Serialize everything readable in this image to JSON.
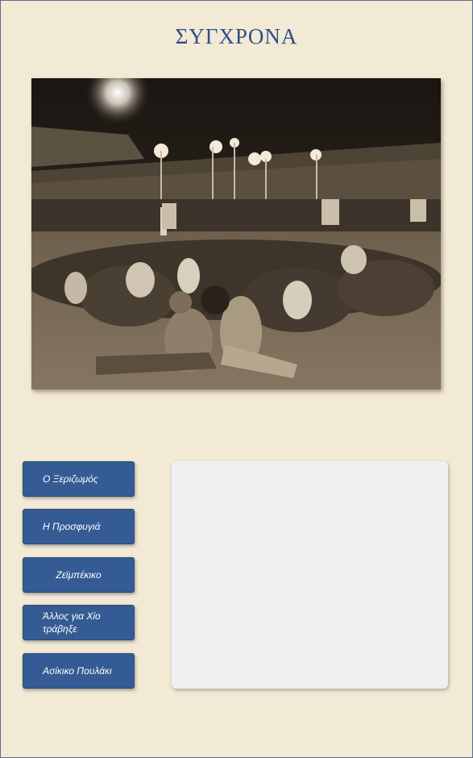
{
  "page": {
    "title": "ΣΥΓΧΡΟΝΑ"
  },
  "photo": {
    "icon": "concert-photo-image"
  },
  "menu": {
    "items": [
      {
        "label": "Ο Ξεριζωμός"
      },
      {
        "label": "Η Προσφυγιά"
      },
      {
        "label": "Ζεϊμπέκικο"
      },
      {
        "label": "Άλλος για Χίο τράβηξε"
      },
      {
        "label": "Ασίκικο Πουλάκι"
      }
    ]
  },
  "colors": {
    "background": "#f3ead5",
    "title": "#2d4f86",
    "button": "#345b94",
    "panel": "#f0f0f0"
  }
}
